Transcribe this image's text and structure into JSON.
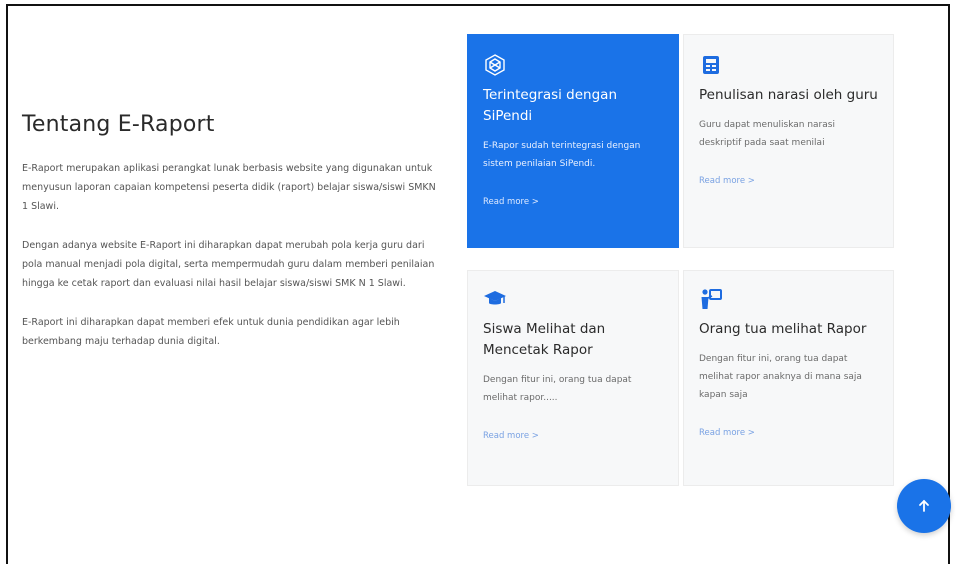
{
  "about": {
    "title": "Tentang E-Raport",
    "paragraphs": [
      "E-Raport merupakan aplikasi perangkat lunak berbasis website yang digunakan untuk menyusun laporan capaian kompetensi peserta didik (raport) belajar siswa/siswi SMKN 1 Slawi.",
      "Dengan adanya website E-Raport ini diharapkan dapat merubah pola kerja guru dari pola manual menjadi pola digital, serta mempermudah guru dalam memberi penilaian hingga ke cetak raport dan evaluasi nilai hasil belajar siswa/siswi SMK N 1 Slawi.",
      "E-Raport ini diharapkan dapat memberi efek untuk dunia pendidikan agar lebih berkembang maju terhadap dunia digital."
    ]
  },
  "cards": [
    {
      "icon": "integration-icon",
      "title": "Terintegrasi dengan SiPendi",
      "text": "E-Rapor sudah terintegrasi dengan sistem penilaian SiPendi.",
      "link": "Read more >"
    },
    {
      "icon": "newspaper-icon",
      "title": "Penulisan narasi oleh guru",
      "text": "Guru dapat menuliskan narasi deskriptif pada saat menilai",
      "link": "Read more >"
    },
    {
      "icon": "graduation-cap-icon",
      "title": "Siswa Melihat dan Mencetak Rapor",
      "text": "Dengan fitur ini, orang tua dapat melihat rapor.....",
      "link": "Read more >"
    },
    {
      "icon": "person-board-icon",
      "title": "Orang tua melihat Rapor",
      "text": "Dengan fitur ini, orang tua dapat melihat rapor anaknya di mana saja kapan saja",
      "link": "Read more >"
    }
  ],
  "colors": {
    "accent": "#1a73e8",
    "card_bg": "#f7f8f9",
    "link": "#7aa2e3"
  },
  "back_to_top": {
    "icon": "arrow-up-icon"
  }
}
